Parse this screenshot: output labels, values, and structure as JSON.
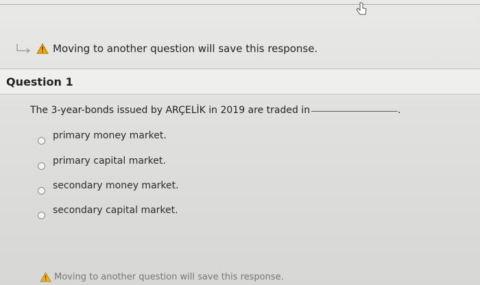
{
  "notice": {
    "text": "Moving to another question will save this response."
  },
  "question": {
    "title": "Question 1",
    "text": "The 3-year-bonds issued by ARÇELİK in 2019 are traded in",
    "trailing_punctuation": ".",
    "options": [
      {
        "label": "primary money market."
      },
      {
        "label": "primary capital market."
      },
      {
        "label": "secondary money market."
      },
      {
        "label": "secondary capital market."
      }
    ]
  },
  "bottom_notice": {
    "text": "Moving to another question will save this response."
  },
  "colors": {
    "warning": "#e2b100",
    "warning_symbol": "#b70000"
  }
}
